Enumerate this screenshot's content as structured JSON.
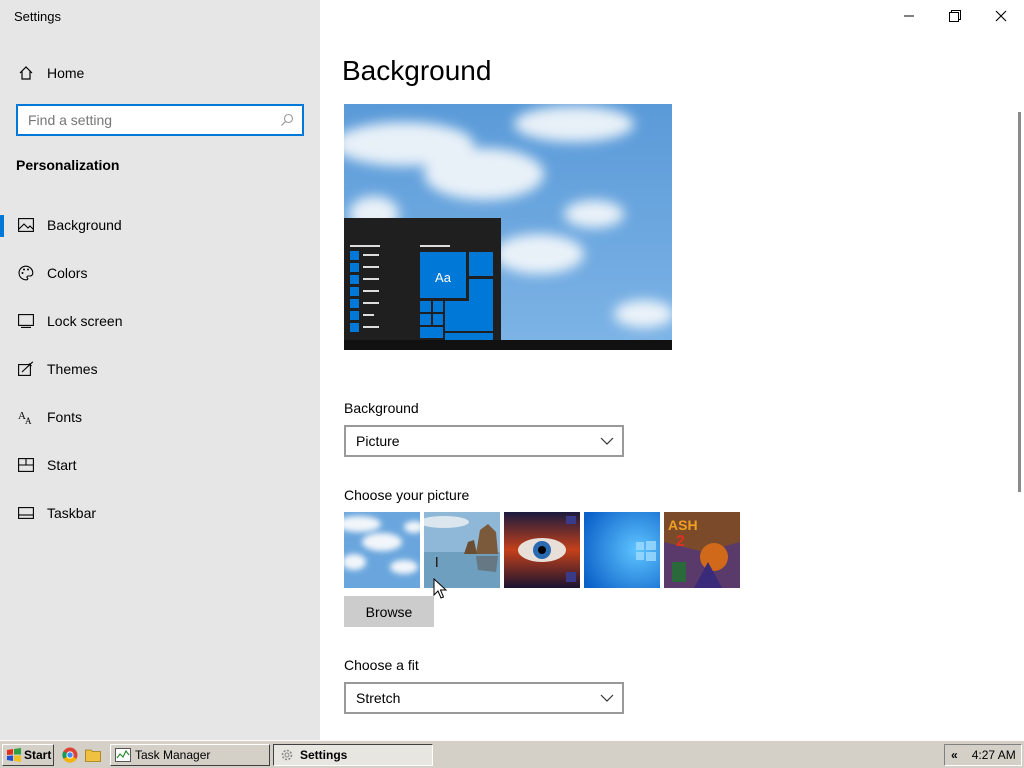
{
  "window": {
    "title": "Settings"
  },
  "sidebar": {
    "home_label": "Home",
    "search_placeholder": "Find a setting",
    "section_title": "Personalization",
    "items": [
      {
        "label": "Background",
        "icon": "picture-icon",
        "active": true
      },
      {
        "label": "Colors",
        "icon": "palette-icon"
      },
      {
        "label": "Lock screen",
        "icon": "lock-screen-icon"
      },
      {
        "label": "Themes",
        "icon": "themes-icon"
      },
      {
        "label": "Fonts",
        "icon": "fonts-icon"
      },
      {
        "label": "Start",
        "icon": "start-icon"
      },
      {
        "label": "Taskbar",
        "icon": "taskbar-icon"
      }
    ]
  },
  "main": {
    "title": "Background",
    "preview_tile_text": "Aa",
    "background_label": "Background",
    "background_value": "Picture",
    "choose_picture_label": "Choose your picture",
    "thumbnails": [
      "clouds",
      "beach-rocks",
      "eye-sunset",
      "windows-blue",
      "crash-bandicoot"
    ],
    "browse_label": "Browse",
    "fit_label": "Choose a fit",
    "fit_value": "Stretch"
  },
  "taskbar": {
    "start_label": "Start",
    "tasks": [
      {
        "label": "Task Manager",
        "active": false
      },
      {
        "label": "Settings",
        "active": true
      }
    ],
    "tray_chevron": "«",
    "clock": "4:27 AM"
  },
  "colors": {
    "accent": "#0078d7",
    "sidebar_bg": "#e6e6e6",
    "taskbar_bg": "#d4d0c8"
  }
}
